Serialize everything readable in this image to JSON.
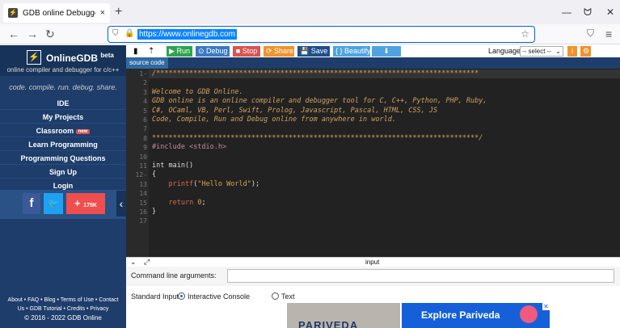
{
  "browser": {
    "tab_title": "GDB online Debugger | Compile",
    "tab_close": "×",
    "new_tab": "+",
    "url": "https://www.onlinegdb.com",
    "min": "—",
    "max": "ᗢ",
    "close": "✕"
  },
  "brand": {
    "name": "OnlineGDB",
    "beta": "beta",
    "tagline": "online compiler and debugger for c/c++",
    "motto": "code. compile. run. debug. share."
  },
  "nav": [
    {
      "label": "IDE"
    },
    {
      "label": "My Projects"
    },
    {
      "label": "Classroom",
      "badge": "new"
    },
    {
      "label": "Learn Programming"
    },
    {
      "label": "Programming Questions"
    },
    {
      "label": "Sign Up"
    },
    {
      "label": "Login"
    }
  ],
  "social": {
    "facebook": "f",
    "twitter": "🐦",
    "plus": "+",
    "count": "175K"
  },
  "footer": {
    "line1": "About • FAQ • Blog • Terms of Use • Contact",
    "line2": "Us • GDB Tutorial • Credits • Privacy",
    "copyright": "© 2016 - 2022 GDB Online"
  },
  "toolbar": {
    "run": "▶ Run",
    "debug": "⊙ Debug",
    "stop": "■ Stop",
    "share": "⟳ Share",
    "save": "💾 Save",
    "beautify": "{ } Beautify",
    "download": "⬇",
    "language_label": "Language",
    "language_value": "-- select --",
    "colors": {
      "run": "#2ea44f",
      "debug": "#3a79c4",
      "stop": "#d9534f",
      "share": "#f0932b",
      "save": "#1e4f8f",
      "beautify": "#4fa3e0",
      "download": "#4fa3e0"
    }
  },
  "source_tab": "source code",
  "code_lines": [
    "/******************************************************************************",
    "",
    "Welcome to GDB Online.",
    "GDB online is an online compiler and debugger tool for C, C++, Python, PHP, Ruby,",
    "C#, OCaml, VB, Perl, Swift, Prolog, Javascript, Pascal, HTML, CSS, JS",
    "Code, Compile, Run and Debug online from anywhere in world.",
    "",
    "*******************************************************************************/",
    "#include <stdio.h>",
    "",
    "int main()",
    "{",
    "    printf(\"Hello World\");",
    "",
    "    return 0;",
    "}",
    ""
  ],
  "io": {
    "header": "input",
    "args_label": "Command line arguments:",
    "stdin_label": "Standard Input:",
    "opt_console": "Interactive Console",
    "opt_text": "Text"
  },
  "ad": {
    "brand": "PARIVEDA",
    "headline": "Explore Pariveda",
    "close": "✕"
  }
}
